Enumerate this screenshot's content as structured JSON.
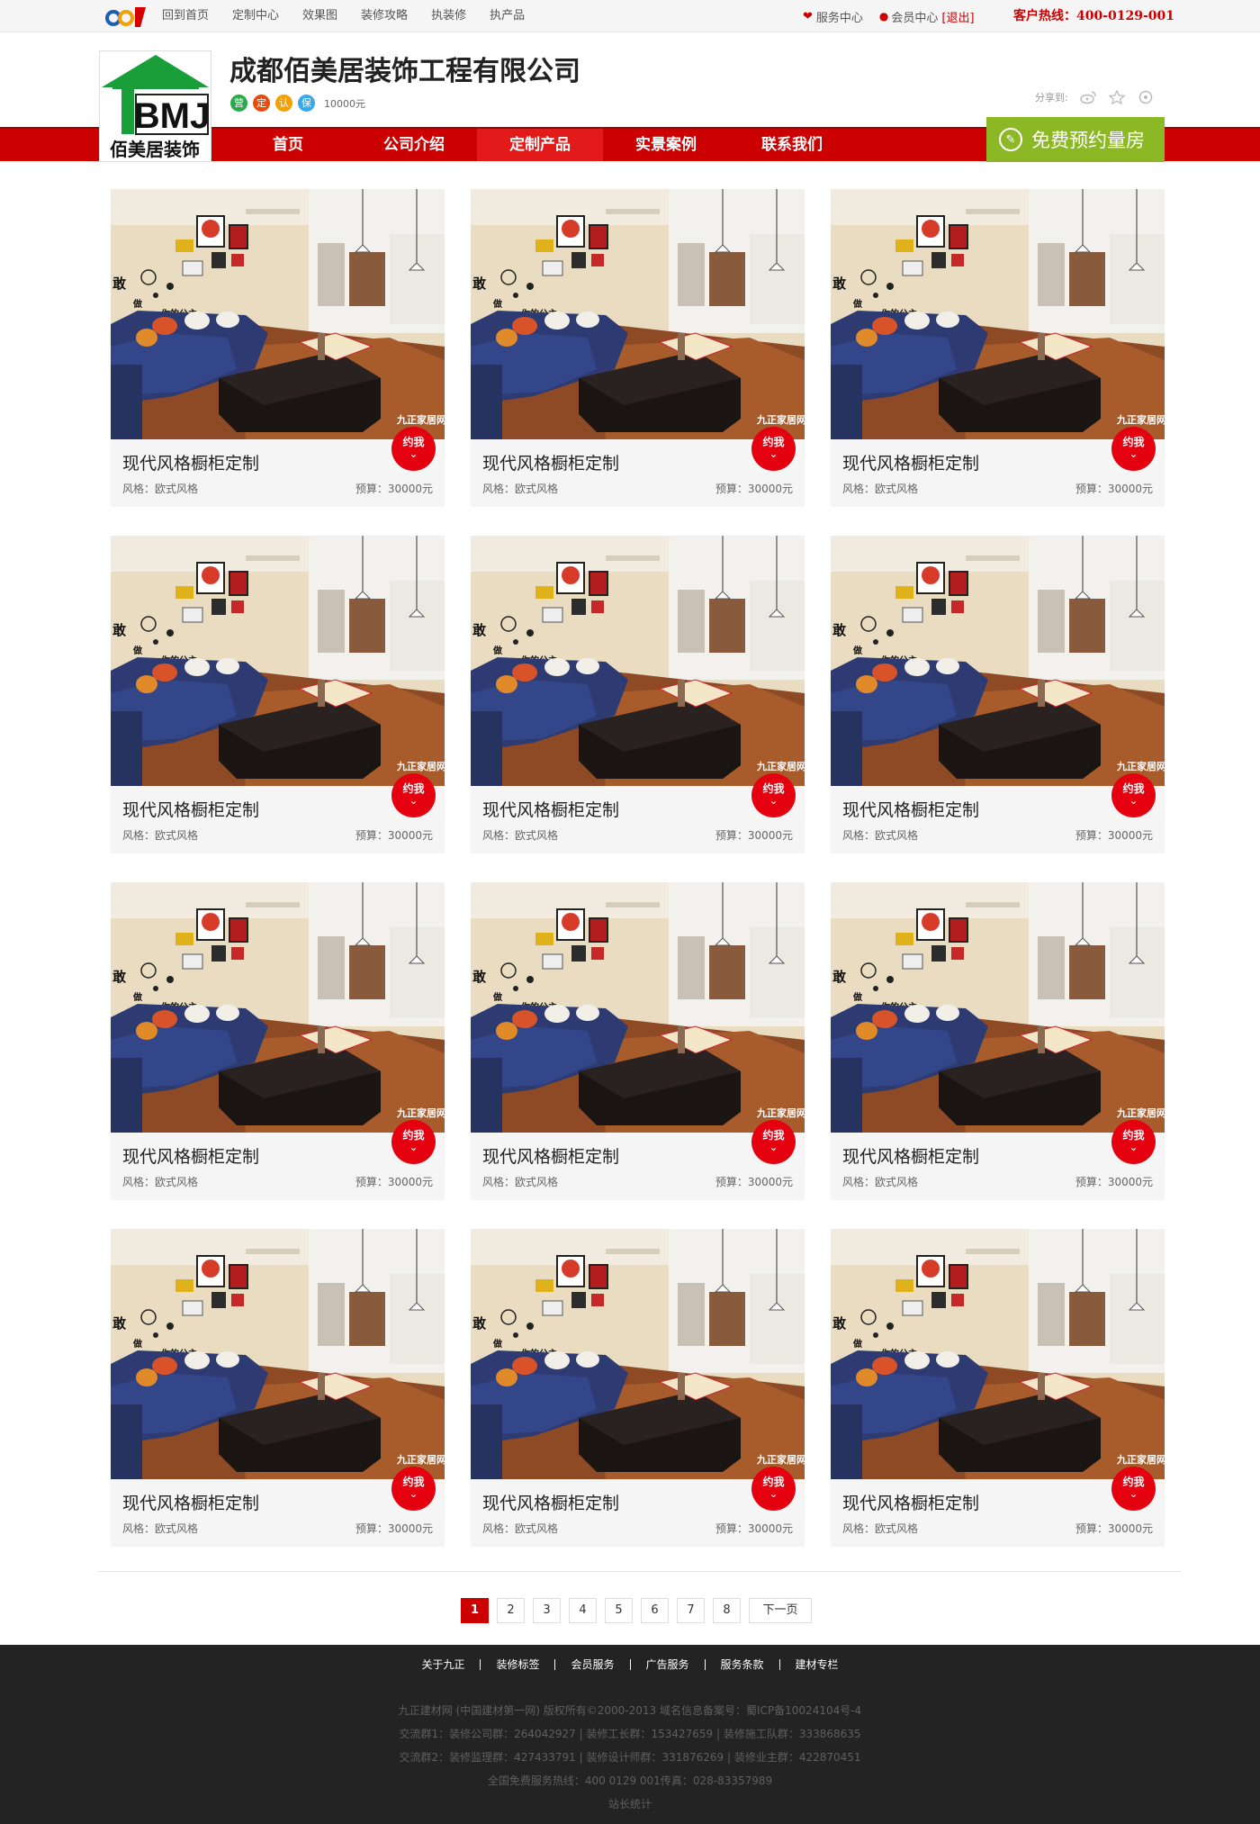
{
  "topbar": {
    "nav": [
      "回到首页",
      "定制中心",
      "效果图",
      "装修攻略",
      "执装修",
      "执产品"
    ],
    "service_center": "服务中心",
    "member_center": "会员中心",
    "logout": "[退出]",
    "hotline": "客户热线：400-0129-001"
  },
  "header": {
    "logo_text": "佰美居装饰",
    "logo_mark": "BMJ",
    "company_name": "成都佰美居装饰工程有限公司",
    "badges": [
      {
        "label": "营",
        "color": "#2aa84a"
      },
      {
        "label": "定",
        "color": "#e84c0c"
      },
      {
        "label": "认",
        "color": "#f2a104"
      },
      {
        "label": "保",
        "color": "#3aa8e8"
      }
    ],
    "deposit": "10000元",
    "share_label": "分享到:",
    "share_icons": [
      "weibo-icon",
      "star-icon",
      "qzone-icon"
    ]
  },
  "nav": {
    "items": [
      "首页",
      "公司介绍",
      "定制产品",
      "实景案例",
      "联系我们"
    ],
    "active_index": 2,
    "book_button": "免费预约量房"
  },
  "cards": [
    {
      "title": "现代风格橱柜定制",
      "style": "风格：欧式风格",
      "budget": "预算：30000元",
      "cta": "约我"
    },
    {
      "title": "现代风格橱柜定制",
      "style": "风格：欧式风格",
      "budget": "预算：30000元",
      "cta": "约我"
    },
    {
      "title": "现代风格橱柜定制",
      "style": "风格：欧式风格",
      "budget": "预算：30000元",
      "cta": "约我"
    },
    {
      "title": "现代风格橱柜定制",
      "style": "风格：欧式风格",
      "budget": "预算：30000元",
      "cta": "约我"
    },
    {
      "title": "现代风格橱柜定制",
      "style": "风格：欧式风格",
      "budget": "预算：30000元",
      "cta": "约我"
    },
    {
      "title": "现代风格橱柜定制",
      "style": "风格：欧式风格",
      "budget": "预算：30000元",
      "cta": "约我"
    },
    {
      "title": "现代风格橱柜定制",
      "style": "风格：欧式风格",
      "budget": "预算：30000元",
      "cta": "约我"
    },
    {
      "title": "现代风格橱柜定制",
      "style": "风格：欧式风格",
      "budget": "预算：30000元",
      "cta": "约我"
    },
    {
      "title": "现代风格橱柜定制",
      "style": "风格：欧式风格",
      "budget": "预算：30000元",
      "cta": "约我"
    },
    {
      "title": "现代风格橱柜定制",
      "style": "风格：欧式风格",
      "budget": "预算：30000元",
      "cta": "约我"
    },
    {
      "title": "现代风格橱柜定制",
      "style": "风格：欧式风格",
      "budget": "预算：30000元",
      "cta": "约我"
    },
    {
      "title": "现代风格橱柜定制",
      "style": "风格：欧式风格",
      "budget": "预算：30000元",
      "cta": "约我"
    }
  ],
  "photo": {
    "wall_text_1": "敢",
    "wall_text_2": "做",
    "wall_text_3": "你的公主",
    "watermark": "九正家居网"
  },
  "pagination": {
    "pages": [
      "1",
      "2",
      "3",
      "4",
      "5",
      "6",
      "7",
      "8"
    ],
    "current": "1",
    "next": "下一页"
  },
  "footer": {
    "links": [
      "关于九正",
      "装修标签",
      "会员服务",
      "广告服务",
      "服务条款",
      "建材专栏"
    ],
    "lines": [
      "九正建材网 (中国建材第一网) 版权所有©2000-2013  域名信息备案号：蜀ICP备10024104号-4",
      "交流群1：装修公司群：264042927 | 装修工长群：153427659 | 装修施工队群：333868635",
      "交流群2：装修监理群：427433791 | 装修设计师群：331876269 | 装修业主群：422870451",
      "全国免费服务热线：400 0129 001传真：028-83357989",
      "站长统计"
    ]
  }
}
